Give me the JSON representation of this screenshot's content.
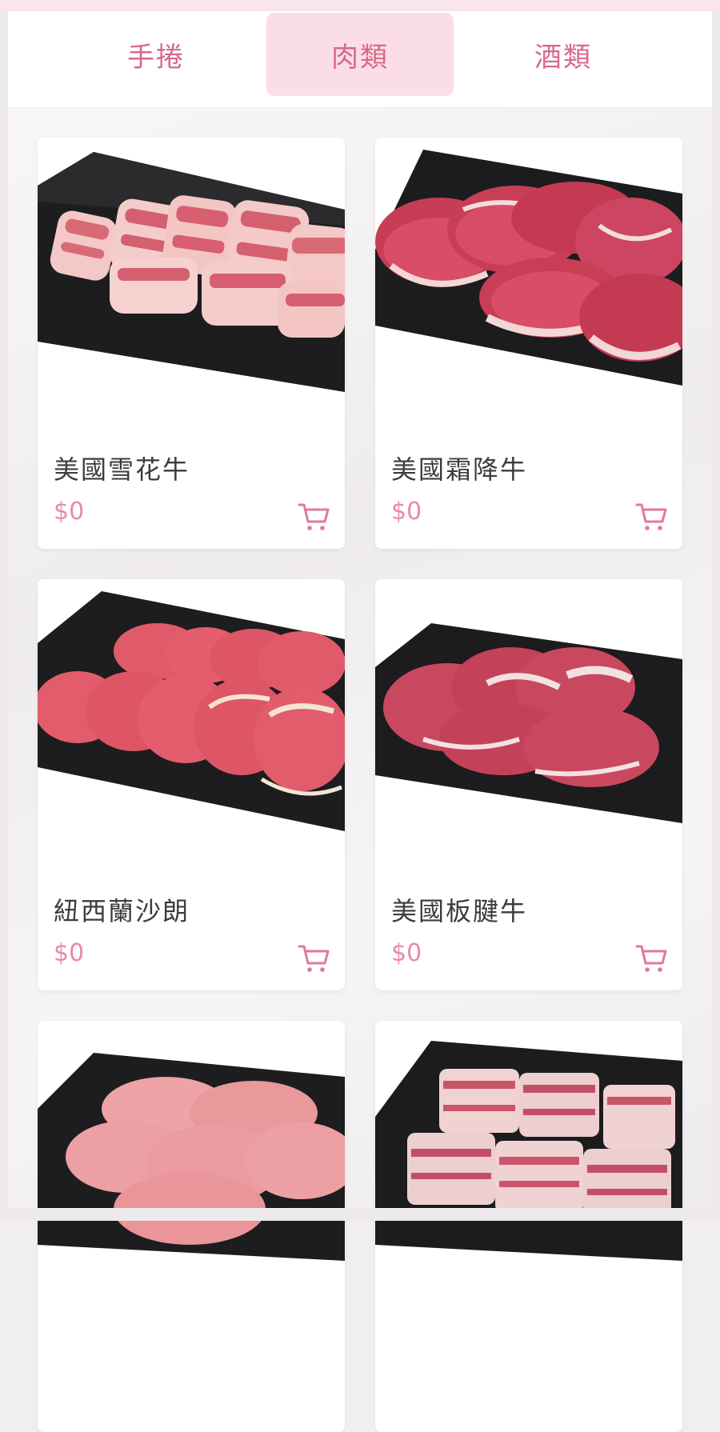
{
  "tabs": [
    {
      "label": "手捲",
      "active": false
    },
    {
      "label": "肉類",
      "active": true
    },
    {
      "label": "酒類",
      "active": false
    }
  ],
  "products": [
    {
      "name": "美國雪花牛",
      "price": "$0",
      "icon": "cart-icon"
    },
    {
      "name": "美國霜降牛",
      "price": "$0",
      "icon": "cart-icon"
    },
    {
      "name": "紐西蘭沙朗",
      "price": "$0",
      "icon": "cart-icon"
    },
    {
      "name": "美國板腱牛",
      "price": "$0",
      "icon": "cart-icon"
    },
    {
      "name": "",
      "price": "",
      "icon": "cart-icon"
    },
    {
      "name": "",
      "price": "",
      "icon": "cart-icon"
    }
  ],
  "colors": {
    "accent": "#d7698b",
    "active_tab_bg": "#fbdde5",
    "price": "#e88aa5"
  }
}
